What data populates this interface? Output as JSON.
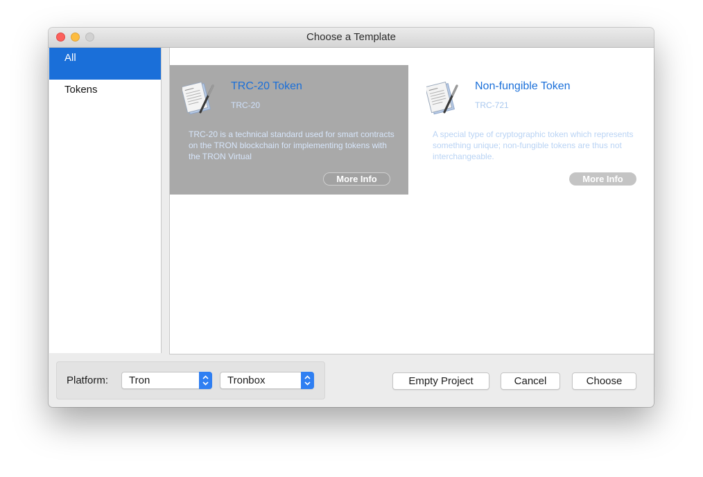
{
  "window": {
    "title": "Choose a Template"
  },
  "sidebar": {
    "items": [
      {
        "label": "All",
        "selected": true
      },
      {
        "label": "Tokens",
        "selected": false
      }
    ]
  },
  "templates": [
    {
      "title": "TRC-20 Token",
      "subtitle": "TRC-20",
      "description": "TRC-20 is a technical standard used for smart contracts on the TRON blockchain for implementing tokens with the TRON Virtual",
      "more_info_label": "More Info",
      "icon": "document-pen-icon",
      "selected": true
    },
    {
      "title": "Non-fungible Token",
      "subtitle": "TRC-721",
      "description": "A special type of cryptographic token which represents something unique; non-fungible tokens are thus not interchangeable.",
      "more_info_label": "More Info",
      "icon": "document-pen-icon",
      "selected": false
    }
  ],
  "footer": {
    "platform_label": "Platform:",
    "platform_value": "Tron",
    "framework_value": "Tronbox",
    "empty_project_label": "Empty Project",
    "cancel_label": "Cancel",
    "choose_label": "Choose"
  },
  "colors": {
    "accent": "#1a6fd9",
    "selection_card": "#a9a9a9",
    "close": "#fc605c",
    "minimize": "#fdbc40",
    "zoom_disabled": "#d1d1d1"
  }
}
